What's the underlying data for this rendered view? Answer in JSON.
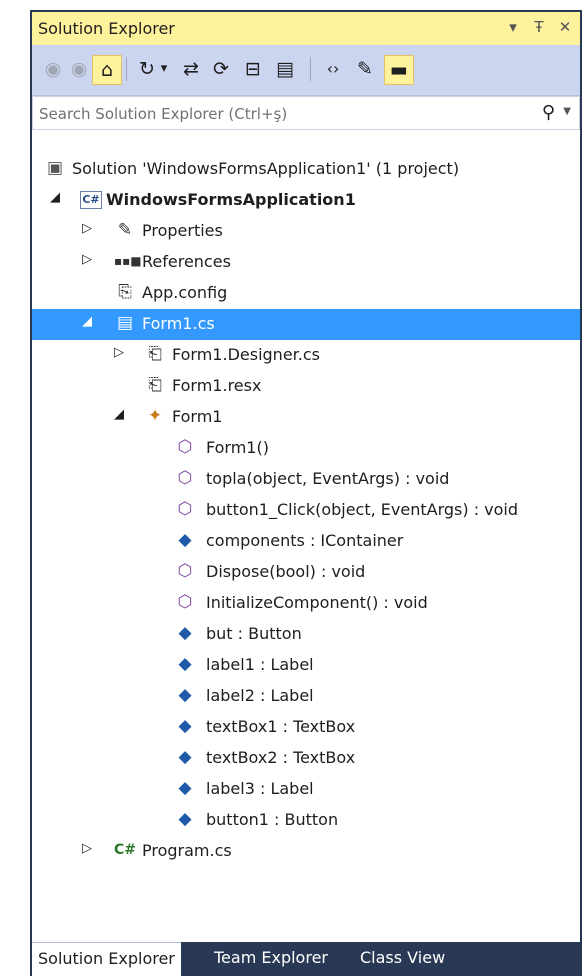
{
  "panel": {
    "title": "Solution Explorer",
    "controls": {
      "dropdown": "▾",
      "pin": "Ŧ",
      "close": "✕"
    }
  },
  "toolbar": {
    "buttons": [
      {
        "icon": "back-icon",
        "glyph": "◉"
      },
      {
        "icon": "forward-icon",
        "glyph": "◉"
      },
      {
        "icon": "home-icon",
        "glyph": "⌂"
      },
      {
        "icon": "history-icon",
        "glyph": "↻"
      },
      {
        "icon": "dropdown-icon",
        "glyph": "▾"
      },
      {
        "icon": "sync-icon",
        "glyph": "⇄"
      },
      {
        "icon": "refresh-icon",
        "glyph": "⟳"
      },
      {
        "icon": "collapse-all-icon",
        "glyph": "⊟"
      },
      {
        "icon": "show-all-files-icon",
        "glyph": "▤"
      },
      {
        "icon": "view-code-icon",
        "glyph": "‹›"
      },
      {
        "icon": "properties-wrench-icon",
        "glyph": "✎"
      },
      {
        "icon": "preview-icon",
        "glyph": "▬"
      }
    ]
  },
  "search": {
    "placeholder": "Search Solution Explorer (Ctrl+ş)",
    "icon": "search-icon"
  },
  "tree": {
    "solution": "Solution 'WindowsFormsApplication1' (1 project)",
    "project": "WindowsFormsApplication1",
    "properties": "Properties",
    "references": "References",
    "app_config": "App.config",
    "form1_cs": "Form1.cs",
    "form1_designer": "Form1.Designer.cs",
    "form1_resx": "Form1.resx",
    "form1_class": "Form1",
    "members": [
      "Form1()",
      "topla(object, EventArgs) : void",
      "button1_Click(object, EventArgs) : void",
      "components : IContainer",
      "Dispose(bool) : void",
      "InitializeComponent() : void",
      "but : Button",
      "label1 : Label",
      "label2 : Label",
      "textBox1 : TextBox",
      "textBox2 : TextBox",
      "label3 : Label",
      "button1 : Button"
    ],
    "program_cs": "Program.cs",
    "cs_badge": "C#",
    "cs_badge_plain": "C#"
  },
  "tabs": [
    "Solution Explorer",
    "Team Explorer",
    "Class View"
  ],
  "colors": {
    "accent_title": "#fff29d",
    "selection": "#3399ff",
    "frame": "#293955"
  }
}
